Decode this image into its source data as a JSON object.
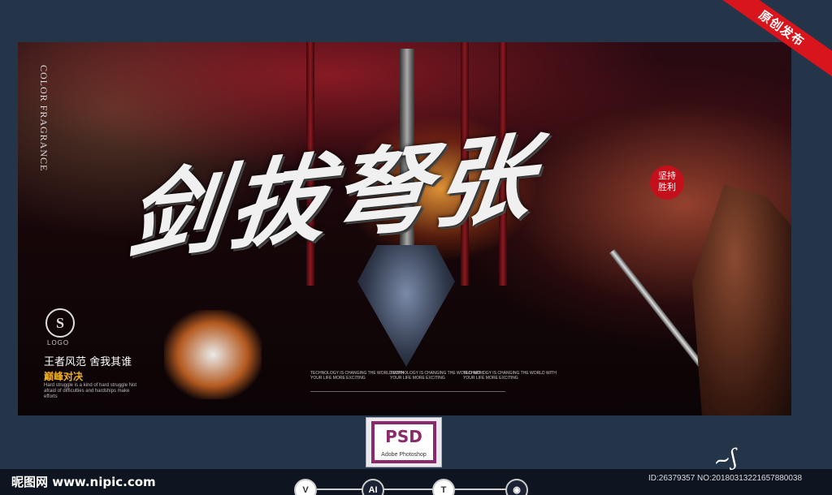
{
  "ribbon": {
    "text": "原创发布"
  },
  "poster": {
    "title": "剑拔弩张",
    "vertical_brand": "COLOR FRAGRANCE",
    "badge_line1": "坚持",
    "badge_line2": "胜利",
    "logo_mark": "S",
    "logo_label": "LOGO",
    "slogan1": "王者风范  舍我其谁",
    "slogan2": "巅峰对决",
    "small_english": "Hard struggle is a kind of hard struggle Not afraid of difficulties and hardships make efforts",
    "tech_blocks": [
      "TECHNOLOGY IS CHANGING THE WORLD WITH YOUR LIFE MORE EXCITING",
      "TECHNOLOGY IS CHANGING THE WORLD WITH YOUR LIFE MORE EXCITING",
      "TECHNOLOGY IS CHANGING THE WORLD WITH YOUR LIFE MORE EXCITING"
    ]
  },
  "format_badge": {
    "label": "PSD",
    "sub": "Adobe Photoshop"
  },
  "footer": {
    "site": "昵图网 www.nipic.com",
    "id_text": "ID:26379357 NO:20180313221657880038",
    "icons": [
      "V",
      "AI",
      "T",
      "eye-icon"
    ]
  }
}
